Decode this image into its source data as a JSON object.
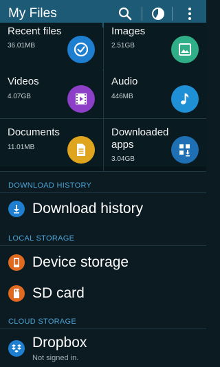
{
  "appbar": {
    "title": "My Files",
    "search_icon": "search-icon",
    "storage_icon": "pie-chart-icon",
    "more_icon": "more-vertical-icon",
    "color": "#1d5a76"
  },
  "categories": [
    {
      "name": "Recent files",
      "size": "36.01MB",
      "icon": "clock-check-icon",
      "color": "#1e7fd0"
    },
    {
      "name": "Images",
      "size": "2.51GB",
      "icon": "image-icon",
      "color": "#2fae87"
    },
    {
      "name": "Videos",
      "size": "4.07GB",
      "icon": "film-icon",
      "color": "#8d3fc8"
    },
    {
      "name": "Audio",
      "size": "446MB",
      "icon": "music-note-icon",
      "color": "#1f8fd6"
    },
    {
      "name": "Documents",
      "size": "11.01MB",
      "icon": "document-icon",
      "color": "#e0a51f"
    },
    {
      "name": "Downloaded apps",
      "size": "3.04GB",
      "icon": "apps-download-icon",
      "color": "#1f6fb5"
    }
  ],
  "sections": {
    "download_history": {
      "header": "DOWNLOAD HISTORY",
      "item": {
        "label": "Download history",
        "icon": "download-icon",
        "color": "#1e7fd0"
      }
    },
    "local_storage": {
      "header": "LOCAL STORAGE",
      "items": [
        {
          "label": "Device storage",
          "icon": "phone-icon",
          "color": "#e06a1f"
        },
        {
          "label": "SD card",
          "icon": "sd-card-icon",
          "color": "#e06a1f"
        }
      ]
    },
    "cloud_storage": {
      "header": "CLOUD STORAGE",
      "items": [
        {
          "label": "Dropbox",
          "sublabel": "Not signed in.",
          "icon": "dropbox-icon",
          "color": "#1e7fd0"
        }
      ]
    }
  },
  "colors": {
    "background": "#0c1b22",
    "section_header": "#4aa3d6"
  }
}
